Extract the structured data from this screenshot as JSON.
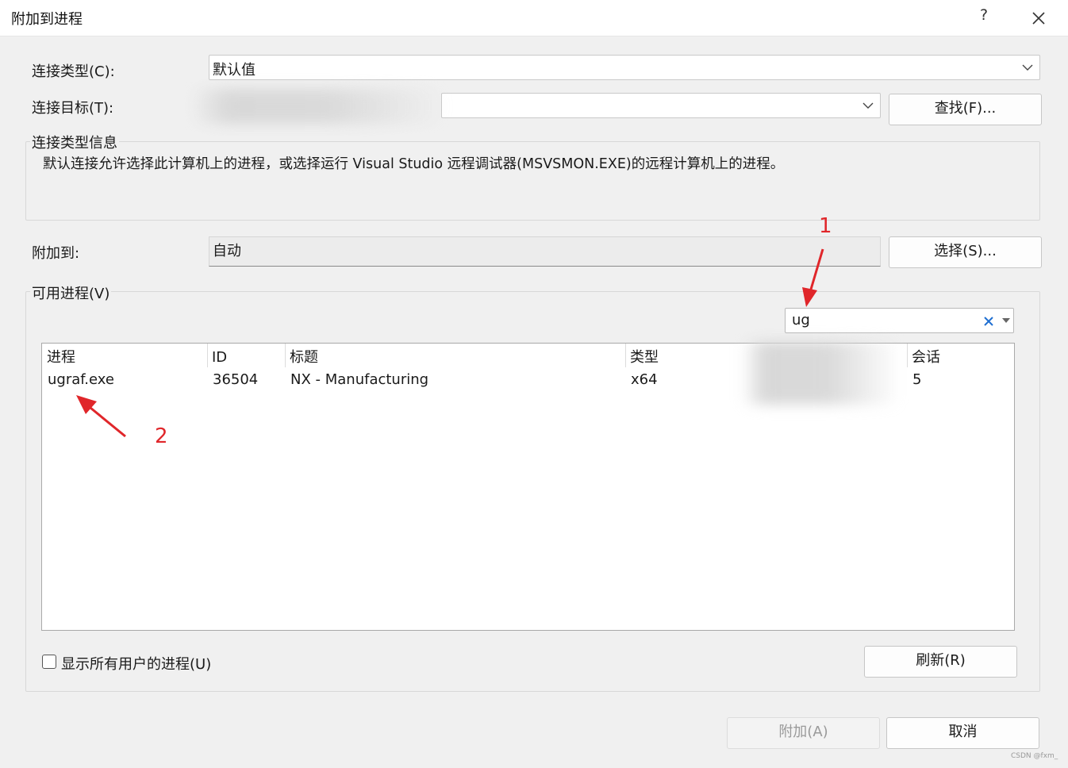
{
  "window": {
    "title": "附加到进程",
    "help_label": "?",
    "close_icon": "close-icon"
  },
  "connection_type": {
    "label": "连接类型(C):",
    "value": "默认值"
  },
  "connection_target": {
    "label": "连接目标(T):",
    "value": "",
    "find_button": "查找(F)..."
  },
  "info_group": {
    "label": "连接类型信息",
    "text": "默认连接允许选择此计算机上的进程，或选择运行 Visual Studio 远程调试器(MSVSMON.EXE)的远程计算机上的进程。"
  },
  "attach_to": {
    "label": "附加到:",
    "value": "自动",
    "select_button": "选择(S)..."
  },
  "processes": {
    "group_label": "可用进程(V)",
    "filter_value": "ug",
    "columns": [
      "进程",
      "ID",
      "标题",
      "类型",
      "",
      "会话"
    ],
    "rows": [
      {
        "process": "ugraf.exe",
        "id": "36504",
        "title": "NX - Manufacturing",
        "type": "x64",
        "hidden": "",
        "session": "5"
      }
    ],
    "show_all_users_label": "显示所有用户的进程(U)",
    "show_all_users_checked": false,
    "refresh_button": "刷新(R)"
  },
  "footer": {
    "attach_button": "附加(A)",
    "cancel_button": "取消",
    "watermark": "CSDN @fxm_"
  },
  "annotations": {
    "marker_1": "1",
    "marker_2": "2",
    "color": "#e0262a"
  }
}
